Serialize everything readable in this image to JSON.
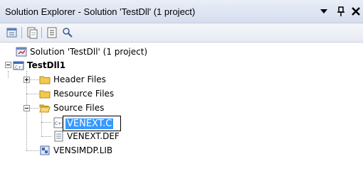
{
  "window": {
    "title": "Solution Explorer - Solution 'TestDll' (1 project)",
    "buttons": [
      "dropdown-icon",
      "pin-icon",
      "close-icon"
    ]
  },
  "toolbar": {
    "tools": [
      "properties-icon",
      "show-all-files-icon",
      "refresh-icon",
      "class-view-icon"
    ]
  },
  "tree": {
    "solution": "Solution 'TestDll' (1 project)",
    "project": "TestDll1",
    "folders": {
      "header": "Header Files",
      "resource": "Resource Files",
      "source": "Source Files"
    },
    "files": {
      "c_file_edit": "VENEXT.C",
      "def_file": "VENEXT.DEF",
      "lib_file": "VENSIMDP.LIB"
    }
  },
  "colors": {
    "selection": "#3399ff",
    "folder": "#f2c94c",
    "title_bg": "#dfe5f2"
  }
}
